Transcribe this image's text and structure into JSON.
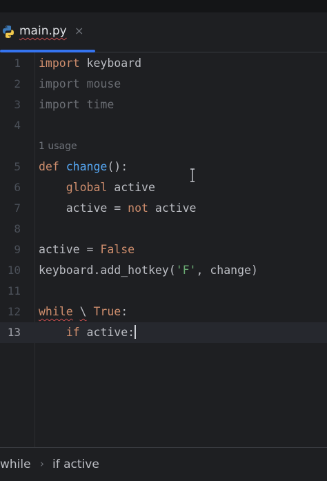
{
  "tab": {
    "filename": "main.py",
    "close_glyph": "×",
    "icon": "python-icon"
  },
  "editor": {
    "usage_hint": "1 usage",
    "lines": [
      {
        "num": "1",
        "tokens": [
          {
            "t": "import",
            "c": "kw"
          },
          {
            "t": " keyboard",
            "c": ""
          }
        ]
      },
      {
        "num": "2",
        "tokens": [
          {
            "t": "import mouse",
            "c": "dim"
          }
        ]
      },
      {
        "num": "3",
        "tokens": [
          {
            "t": "import time",
            "c": "dim"
          }
        ]
      },
      {
        "num": "4",
        "tokens": []
      },
      {
        "num": "5",
        "tokens": [
          {
            "t": "def",
            "c": "kw"
          },
          {
            "t": " ",
            "c": ""
          },
          {
            "t": "change",
            "c": "fn"
          },
          {
            "t": "():",
            "c": ""
          }
        ]
      },
      {
        "num": "6",
        "tokens": [
          {
            "t": "    ",
            "c": ""
          },
          {
            "t": "global",
            "c": "kw"
          },
          {
            "t": " active",
            "c": ""
          }
        ]
      },
      {
        "num": "7",
        "tokens": [
          {
            "t": "    active = ",
            "c": ""
          },
          {
            "t": "not",
            "c": "kw"
          },
          {
            "t": " active",
            "c": ""
          }
        ]
      },
      {
        "num": "8",
        "tokens": []
      },
      {
        "num": "9",
        "tokens": [
          {
            "t": "active = ",
            "c": ""
          },
          {
            "t": "False",
            "c": "kw"
          }
        ]
      },
      {
        "num": "10",
        "tokens": [
          {
            "t": "keyboard.add_hotkey(",
            "c": ""
          },
          {
            "t": "'F'",
            "c": "str"
          },
          {
            "t": ", change)",
            "c": ""
          }
        ]
      },
      {
        "num": "11",
        "tokens": []
      },
      {
        "num": "12",
        "tokens": [
          {
            "t": "while",
            "c": "kw wavy"
          },
          {
            "t": " ",
            "c": ""
          },
          {
            "t": "\\",
            "c": "wavy"
          },
          {
            "t": " ",
            "c": ""
          },
          {
            "t": "True",
            "c": "kw"
          },
          {
            "t": ":",
            "c": ""
          }
        ]
      },
      {
        "num": "13",
        "tokens": [
          {
            "t": "    ",
            "c": ""
          },
          {
            "t": "if",
            "c": "kw"
          },
          {
            "t": " active:",
            "c": ""
          }
        ],
        "current": true,
        "caret": true
      }
    ]
  },
  "breadcrumb": {
    "items": [
      "while",
      "if active"
    ],
    "separator": "›"
  },
  "colors": {
    "background": "#1e1f22",
    "keyword": "#cf8e6d",
    "function": "#56a8f5",
    "string": "#6aab73",
    "accent": "#3574f0"
  }
}
